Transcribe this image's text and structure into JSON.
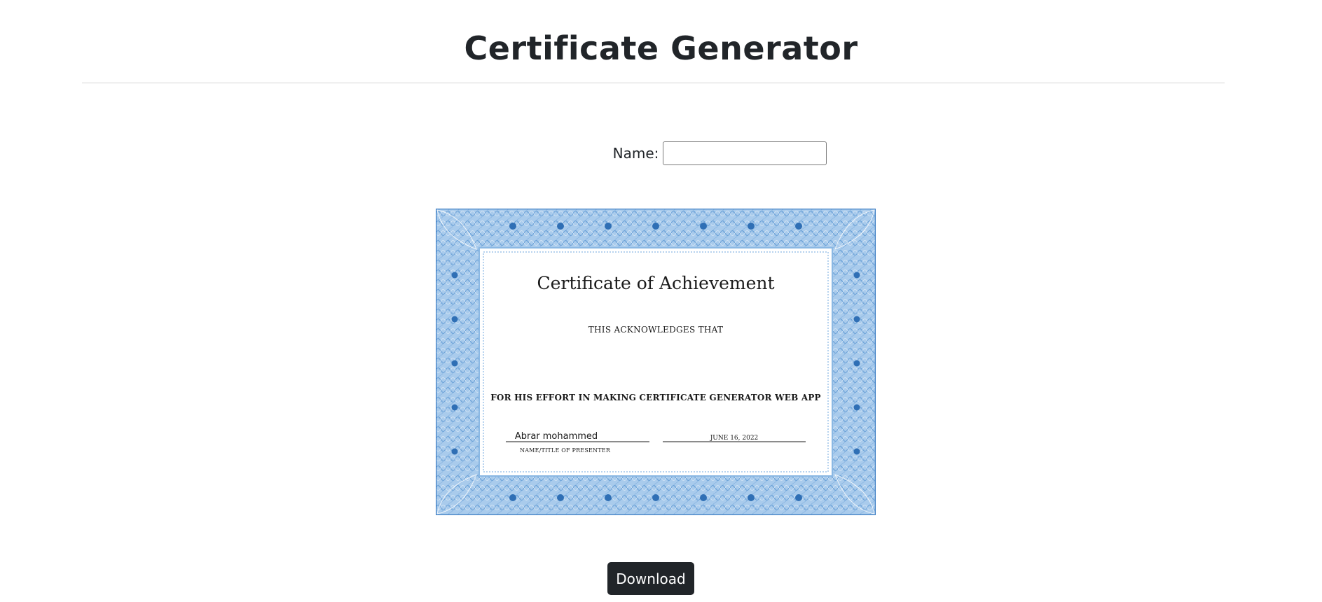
{
  "header": {
    "title": "Certificate Generator"
  },
  "form": {
    "name_label": "Name:",
    "name_value": "",
    "name_placeholder": ""
  },
  "certificate": {
    "title": "Certificate of Achievement",
    "acknowledges": "THIS ACKNOWLEDGES THAT",
    "reason": "FOR HIS EFFORT IN MAKING CERTIFICATE GENERATOR WEB APP",
    "presenter_name": "Abrar mohammed",
    "presenter_label": "NAME/TITLE OF PRESENTER",
    "date": "JUNE 16, 2022",
    "border_color": "#7fb0de",
    "border_accent": "#3f7fc4"
  },
  "actions": {
    "download_label": "Download",
    "button_color": "#212529"
  }
}
